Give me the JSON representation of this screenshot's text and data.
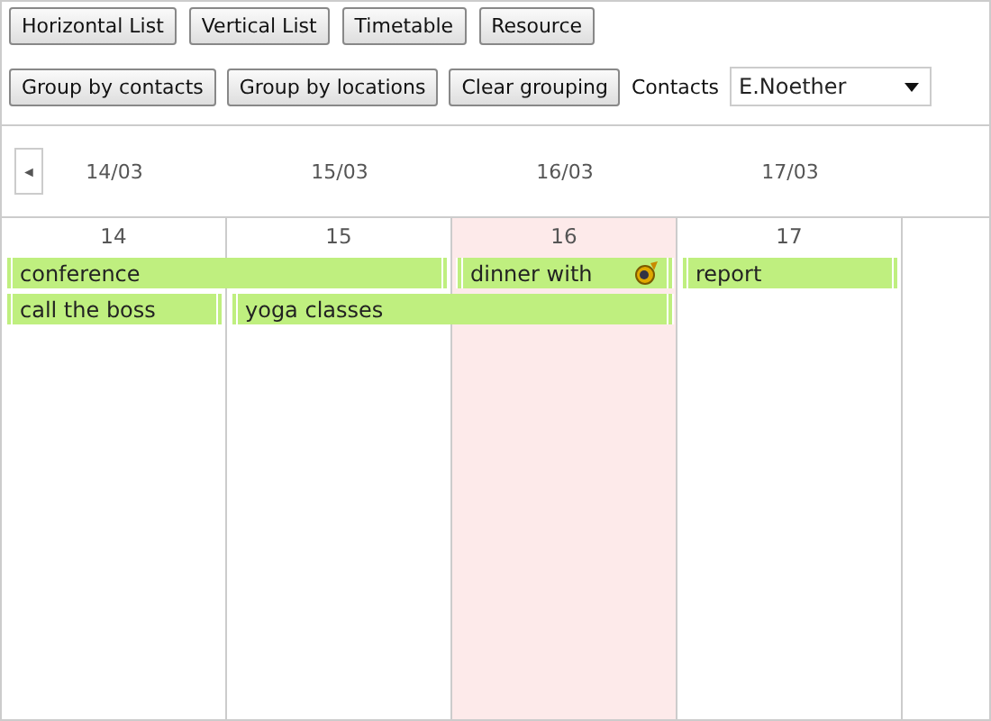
{
  "view_buttons": [
    "Horizontal List",
    "Vertical List",
    "Timetable",
    "Resource"
  ],
  "group_buttons": [
    "Group by contacts",
    "Group by locations",
    "Clear grouping"
  ],
  "contacts": {
    "label": "Contacts",
    "value": "E.Noether"
  },
  "nav": {
    "prev": "◄"
  },
  "header_dates": [
    "14/03",
    "15/03",
    "16/03",
    "17/03"
  ],
  "days": [
    {
      "label": "14",
      "highlighted": false
    },
    {
      "label": "15",
      "highlighted": false
    },
    {
      "label": "16",
      "highlighted": true
    },
    {
      "label": "17",
      "highlighted": false
    }
  ],
  "lanes": [
    [
      {
        "kind": "start",
        "title": "conference",
        "has_icon": false
      },
      {
        "kind": "continue"
      },
      {
        "kind": "start",
        "title": "dinner with",
        "has_icon": true
      },
      {
        "kind": "start",
        "title": "report",
        "has_icon": false
      }
    ],
    [
      {
        "kind": "start",
        "title": "call the boss",
        "has_icon": false
      },
      {
        "kind": "start",
        "title": "yoga classes",
        "has_icon": false
      },
      {
        "kind": "continue"
      }
    ]
  ]
}
